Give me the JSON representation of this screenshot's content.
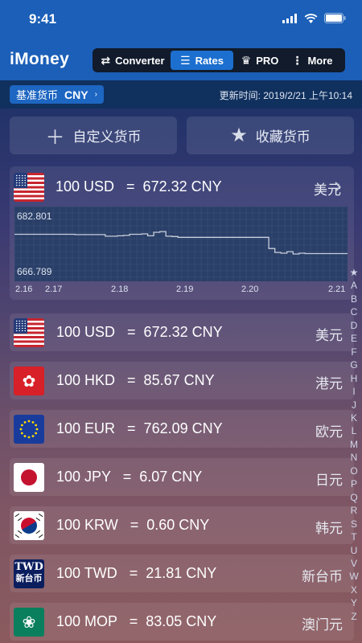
{
  "status_bar": {
    "time": "9:41"
  },
  "header": {
    "title": "iMoney",
    "tabs": [
      {
        "label": "Converter",
        "icon": "swap-icon",
        "active": false
      },
      {
        "label": "Rates",
        "icon": "list-icon",
        "active": true
      },
      {
        "label": "PRO",
        "icon": "crown-icon",
        "active": false
      },
      {
        "label": "More",
        "icon": "dots-icon",
        "active": false
      }
    ]
  },
  "subbar": {
    "base_label": "基准货币",
    "base_currency": "CNY",
    "updated": "更新时间: 2019/2/21 上午10:14"
  },
  "actions": {
    "custom_label": "自定义货币",
    "favorites_label": "收藏货币"
  },
  "featured": {
    "rate": "100 USD   =  672.32 CNY",
    "name": "美元",
    "flag": "us-flag"
  },
  "chart_data": {
    "type": "line",
    "x": [
      "2.16",
      "2.17",
      "2.18",
      "2.19",
      "2.20",
      "2.21"
    ],
    "y_max_label": "682.801",
    "y_min_label": "666.789",
    "ylim": [
      666.789,
      682.801
    ],
    "series": [
      {
        "values": [
          677.3,
          677.3,
          677.3,
          677.3,
          677.3,
          677.3,
          677.3,
          677.3,
          677.3,
          677.3,
          677.2,
          677.2,
          677.2,
          677.2,
          677.2,
          676.8,
          676.8,
          676.9,
          677.0,
          677.3,
          677.3,
          677.4,
          676.9,
          677.8,
          678.0,
          676.8,
          676.7,
          676.5,
          676.5,
          676.5,
          676.5,
          676.5,
          676.5,
          676.5,
          676.5,
          676.5,
          676.5,
          676.5,
          676.5,
          676.5,
          676.5,
          676.5,
          673.6,
          672.6,
          672.4,
          672.8,
          672.2,
          672.4,
          672.3,
          672.3,
          672.3,
          672.3,
          672.3,
          672.3,
          672.3,
          672.4
        ]
      }
    ],
    "grid": true,
    "line_color": "#c8cedb"
  },
  "rates": [
    {
      "rate": "100 USD   =  672.32 CNY",
      "name": "美元",
      "flag": "us-flag"
    },
    {
      "rate": "100 HKD   =  85.67 CNY",
      "name": "港元",
      "flag": "hk-flag"
    },
    {
      "rate": "100 EUR   =  762.09 CNY",
      "name": "欧元",
      "flag": "eu-flag"
    },
    {
      "rate": "100 JPY   =  6.07 CNY",
      "name": "日元",
      "flag": "jp-flag"
    },
    {
      "rate": "100 KRW   =  0.60 CNY",
      "name": "韩元",
      "flag": "kr-flag"
    },
    {
      "rate": "100 TWD   =  21.81 CNY",
      "name": "新台币",
      "flag": "tw-flag",
      "flag_text": [
        "TWD",
        "新台币"
      ]
    },
    {
      "rate": "100 MOP   =  83.05 CNY",
      "name": "澳门元",
      "flag": "mo-flag"
    }
  ],
  "index_letters": [
    "★",
    "A",
    "B",
    "C",
    "D",
    "E",
    "F",
    "G",
    "H",
    "I",
    "J",
    "K",
    "L",
    "M",
    "N",
    "O",
    "P",
    "Q",
    "R",
    "S",
    "T",
    "U",
    "V",
    "W",
    "X",
    "Y",
    "Z"
  ]
}
